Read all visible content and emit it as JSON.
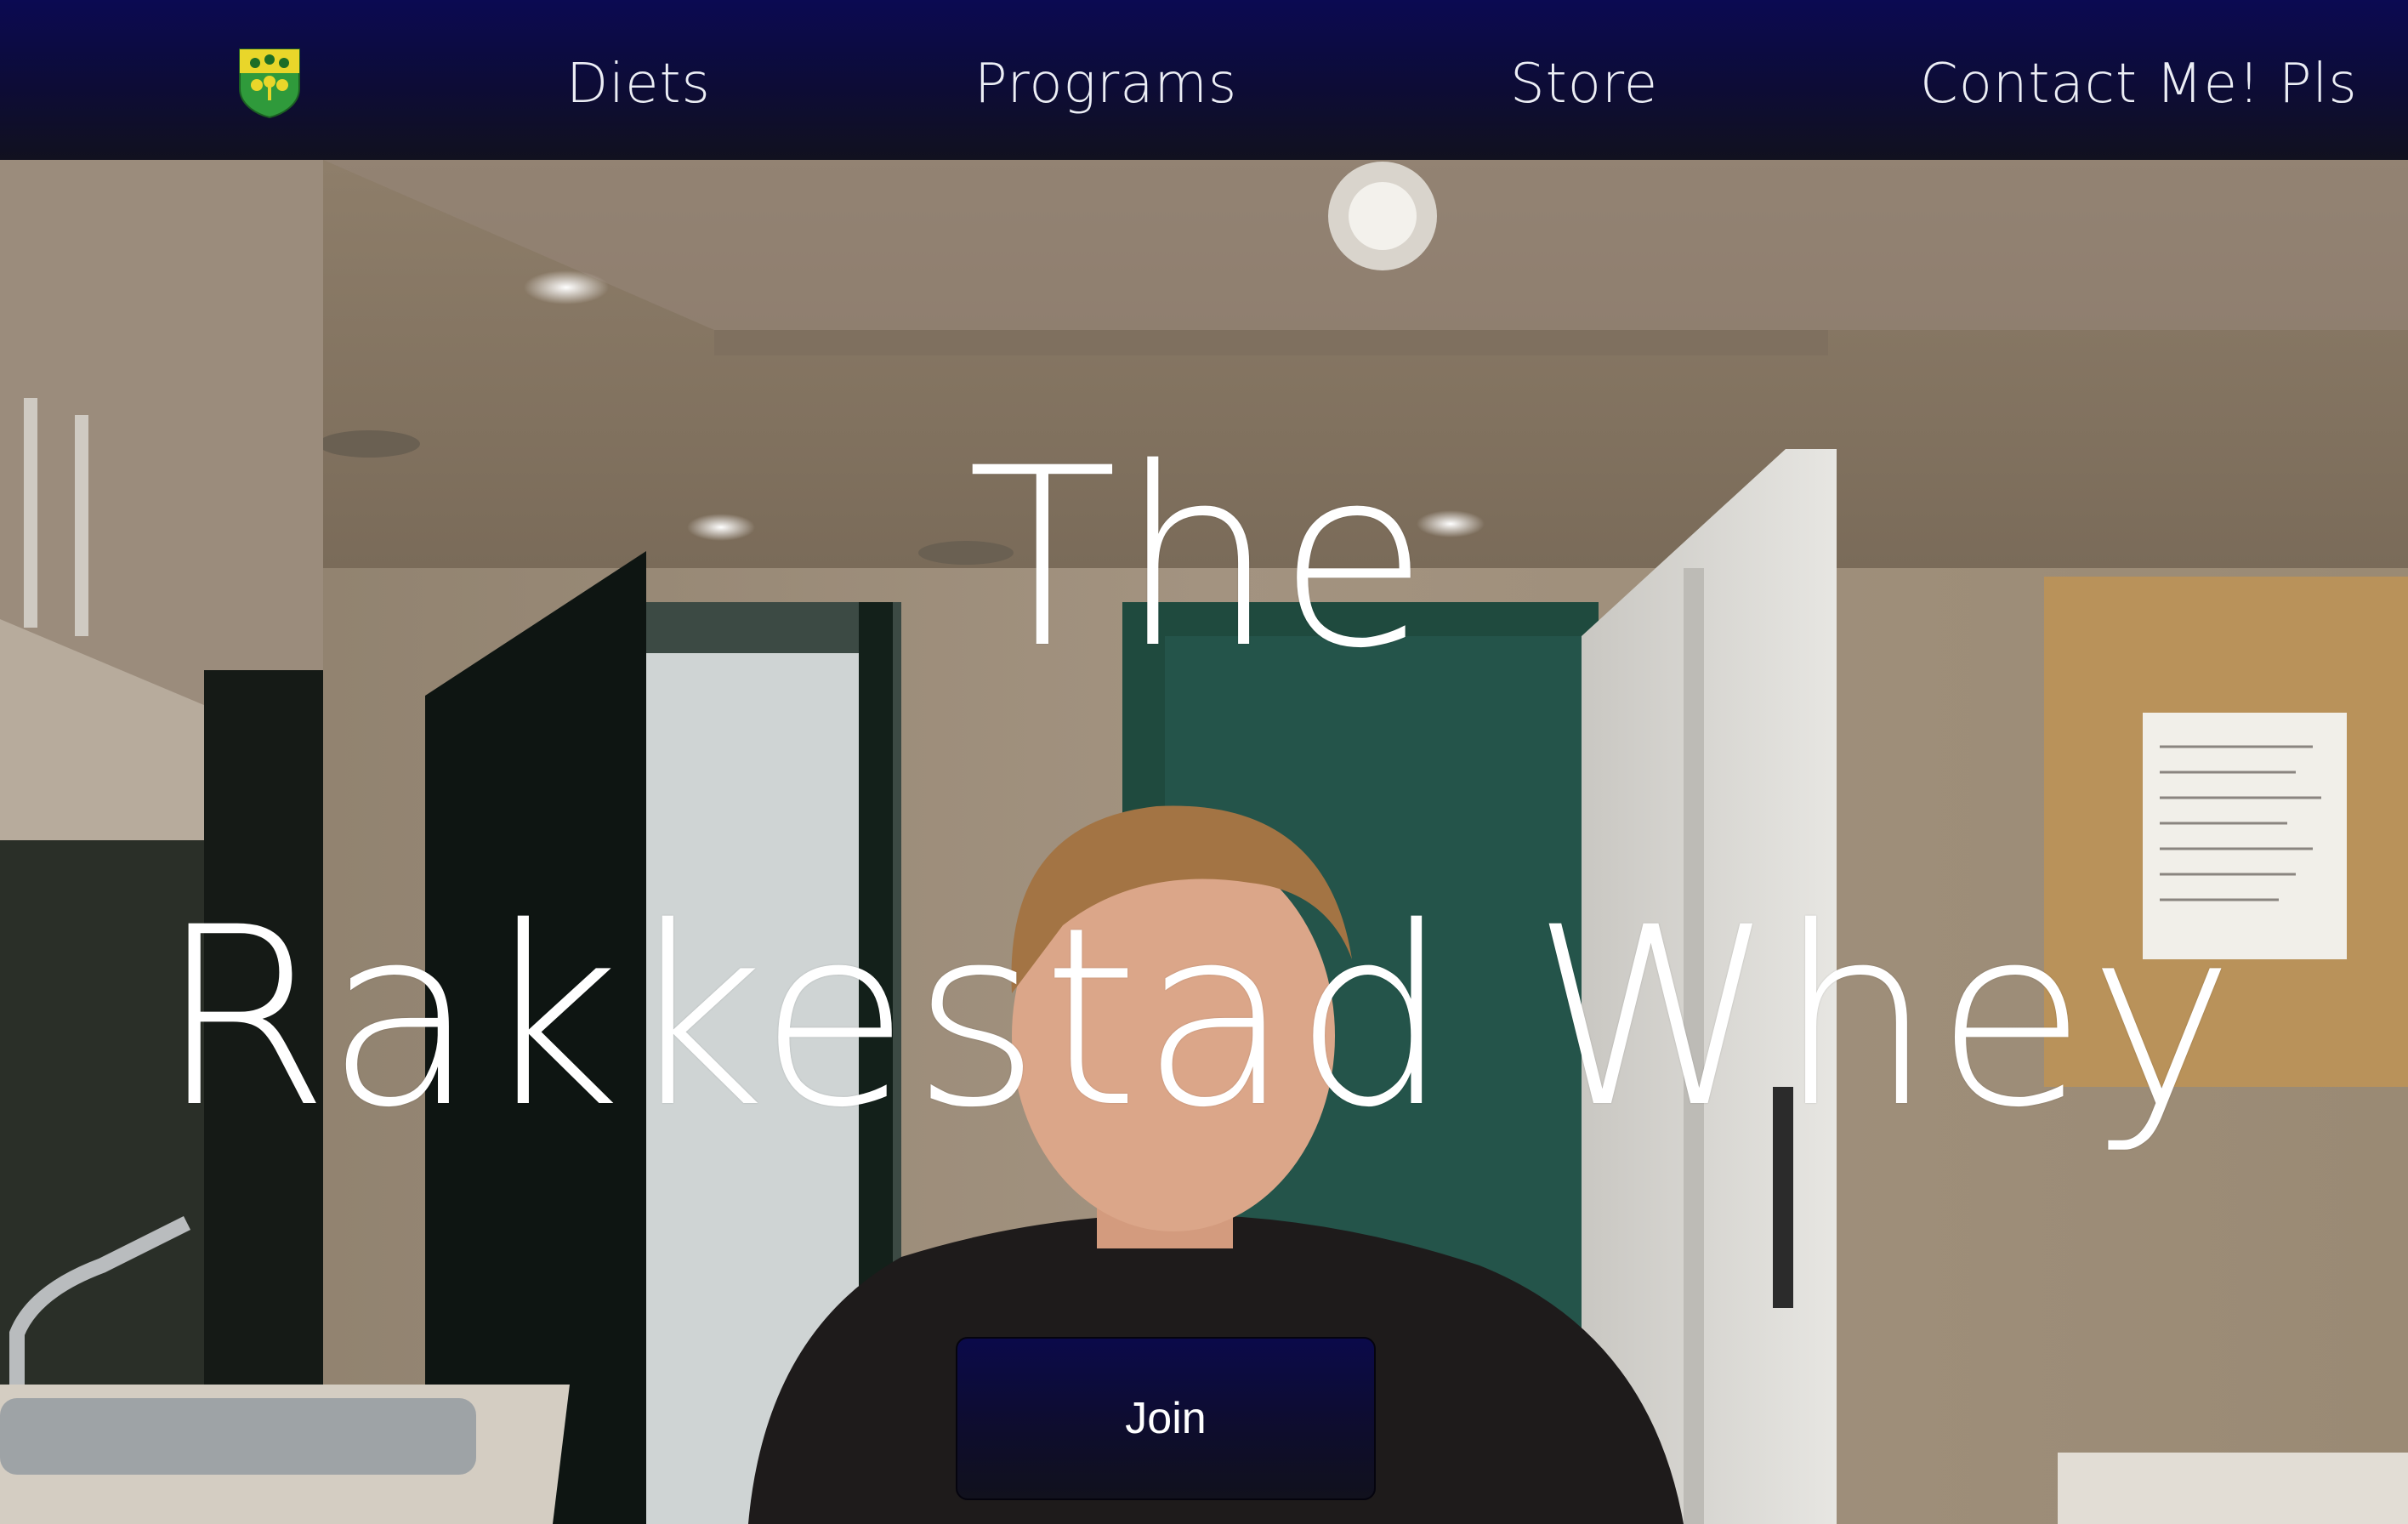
{
  "nav": {
    "logo_icon": "shield-crest-icon",
    "links": [
      {
        "label": "Diets"
      },
      {
        "label": "Programs"
      },
      {
        "label": "Store"
      },
      {
        "label": "Contact Me! Pls"
      }
    ]
  },
  "hero": {
    "title_line1": "The",
    "title_line2": "Rakkestad Whey",
    "cta_label": "Join",
    "background_icon": "hero-photo"
  },
  "colors": {
    "nav_background": "#0b0a52",
    "button_background": "#0e0d2c",
    "text": "#ffffff"
  }
}
